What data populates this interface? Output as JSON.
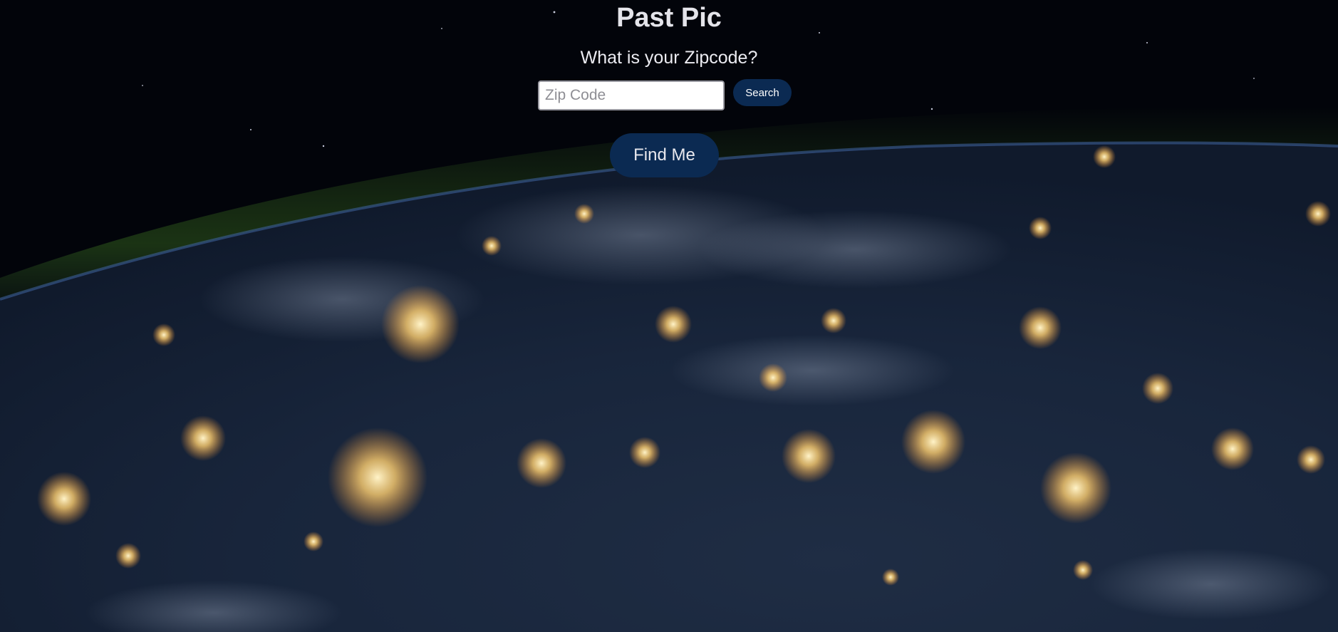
{
  "page": {
    "title": "Past Pic",
    "question": "What is your Zipcode?"
  },
  "search": {
    "placeholder": "Zip Code",
    "value": "",
    "button_label": "Search"
  },
  "locate": {
    "button_label": "Find Me"
  },
  "background": {
    "scene": "earth-at-night-from-space",
    "colors": {
      "space": "#02040a",
      "earth": "#1a2a45",
      "atmosphere": "#2f5a1c",
      "city_lights": "#ffd27a",
      "button": "#0b2a52"
    }
  }
}
